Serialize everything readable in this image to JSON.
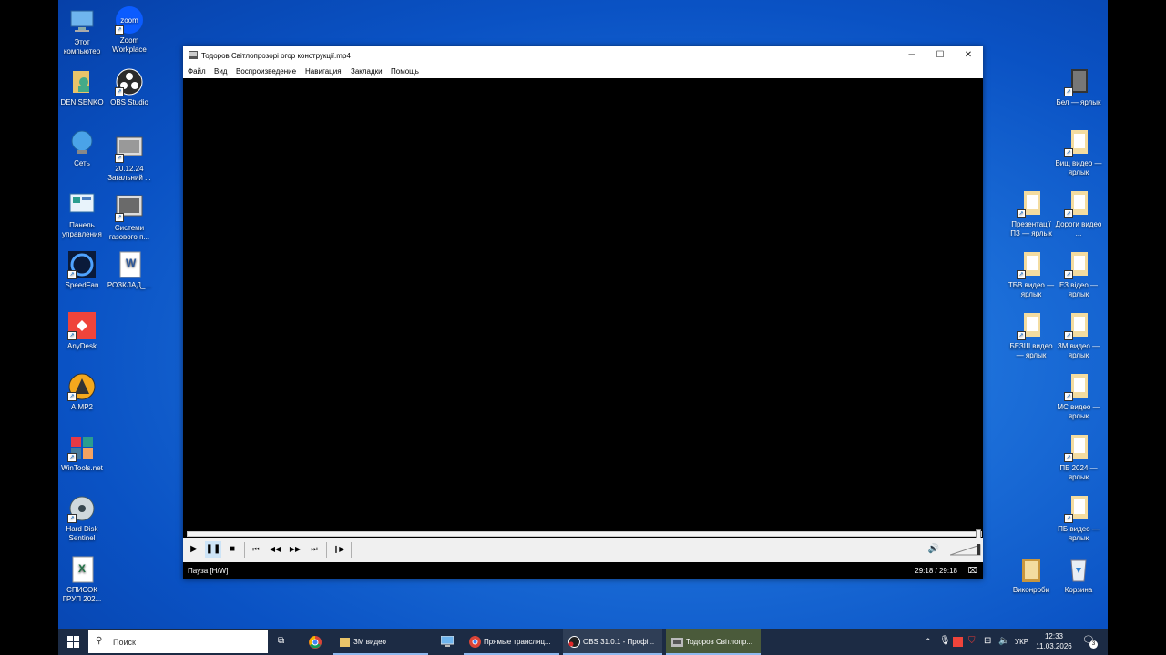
{
  "desktop": {
    "left_icons": [
      {
        "label": "Этот компьютер",
        "icon": "this-pc-icon"
      },
      {
        "label": "Zoom Workplace",
        "icon": "zoom-icon"
      },
      {
        "label": "DENISENKO",
        "icon": "user-folder-icon"
      },
      {
        "label": "OBS Studio",
        "icon": "obs-icon"
      },
      {
        "label": "Сеть",
        "icon": "network-icon"
      },
      {
        "label": "20.12.24 Загальний ...",
        "icon": "video-file-icon"
      },
      {
        "label": "Панель управления",
        "icon": "control-panel-icon"
      },
      {
        "label": "Системи газового п...",
        "icon": "video-file-icon"
      },
      {
        "label": "SpeedFan",
        "icon": "speedfan-icon"
      },
      {
        "label": "РОЗКЛАД_...",
        "icon": "word-doc-icon"
      },
      {
        "label": "AnyDesk",
        "icon": "anydesk-icon"
      },
      {
        "label": "AIMP2",
        "icon": "aimp-icon"
      },
      {
        "label": "WinTools.net",
        "icon": "wintools-icon"
      },
      {
        "label": "Hard Disk Sentinel",
        "icon": "hdd-sentinel-icon"
      },
      {
        "label": "СПИСОК ГРУП 202...",
        "icon": "excel-doc-icon"
      }
    ],
    "right_icons": [
      {
        "label": "Бел — ярлык",
        "icon": "folder-shortcut-icon"
      },
      {
        "label": "Вищ видео — ярлык",
        "icon": "folder-shortcut-icon"
      },
      {
        "label": "Презентації ПЗ — ярлык",
        "icon": "folder-shortcut-icon"
      },
      {
        "label": "Дороги видео ...",
        "icon": "folder-shortcut-icon"
      },
      {
        "label": "ТБВ видео — ярлык",
        "icon": "folder-shortcut-icon"
      },
      {
        "label": "ЕЗ відео — ярлык",
        "icon": "folder-shortcut-icon"
      },
      {
        "label": "БЕЗШ видео — ярлык",
        "icon": "folder-shortcut-icon"
      },
      {
        "label": "ЗМ видео — ярлык",
        "icon": "folder-shortcut-icon"
      },
      {
        "label": "МС видео — ярлык",
        "icon": "folder-shortcut-icon"
      },
      {
        "label": "ПБ 2024 — ярлык",
        "icon": "folder-shortcut-icon"
      },
      {
        "label": "ПБ видео — ярлык",
        "icon": "folder-shortcut-icon"
      },
      {
        "label": "Виконроби",
        "icon": "folder-icon"
      },
      {
        "label": "Корзина",
        "icon": "recycle-bin-icon"
      }
    ]
  },
  "player": {
    "title": "Тодоров Світлопрозорі огор конструкції.mp4",
    "menu": [
      "Файл",
      "Вид",
      "Воспроизведение",
      "Навигация",
      "Закладки",
      "Помощь"
    ],
    "status": "Пауза [H/W]",
    "time": "29:18 / 29:18",
    "progress": 1.0
  },
  "taskbar": {
    "search_placeholder": "Поиск",
    "items": [
      {
        "label": "ЗМ видео",
        "icon": "folder-icon"
      },
      {
        "label": "Прямые трансляц...",
        "icon": "chrome-icon"
      },
      {
        "label": "OBS 31.0.1 - Профі...",
        "icon": "obs-icon"
      },
      {
        "label": "Тодоров Світлопр...",
        "icon": "mpc-icon"
      }
    ],
    "language": "УКР",
    "clock_time": "12:33",
    "clock_date": "11.03.2026",
    "notification_count": "3"
  },
  "colors": {
    "desktop": "#1c6fd9",
    "taskbar": "#1c2b44",
    "active_item": "#4a5a3a"
  }
}
